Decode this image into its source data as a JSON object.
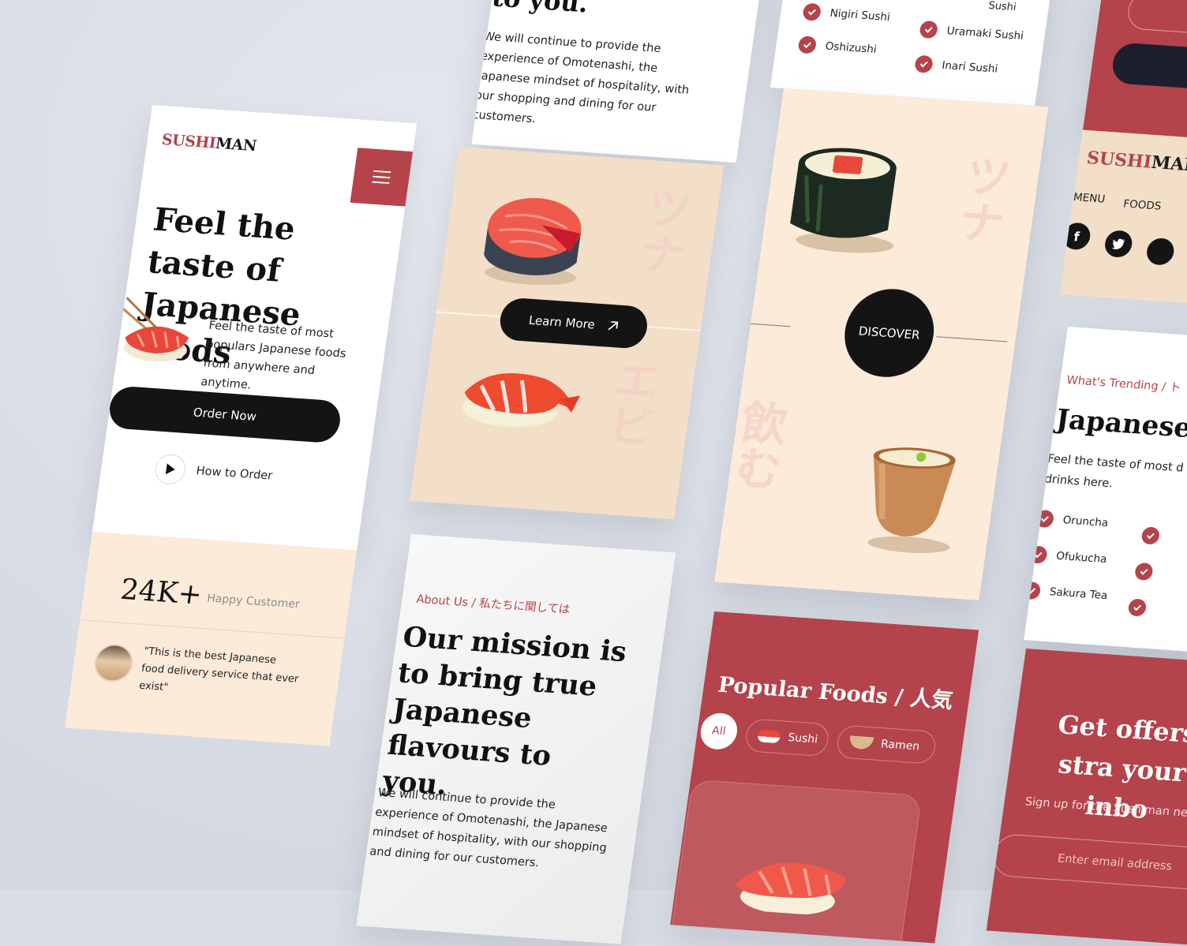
{
  "hero": {
    "brand_red": "SUSHI",
    "brand_dark": "MAN",
    "headline": "Feel the taste of Japanese foods",
    "description": "Feel the taste of most populars Japanese foods from anywhere and anytime.",
    "order_button": "Order Now",
    "how_to_order": "How to Order",
    "stat_number": "24K+",
    "stat_label": "Happy Customer",
    "testimonial": "\"This is the best Japanese food delivery service that ever exist\""
  },
  "about_top": {
    "title_fragment": "to you.",
    "body": "We will continue to provide the experience of Omotenashi, the Japanese mindset of hospitality, with our shopping and dining for our customers."
  },
  "food_showcase": {
    "learn_more": "Learn More",
    "kana_top": "ツナ",
    "kana_bottom": "エビ"
  },
  "about": {
    "eyebrow": "About Us / 私たちに関しては",
    "title": "Our mission is to bring true Japanese flavours to you.",
    "body": "We will continue to provide the experience of Omotenashi, the Japanese mindset of hospitality, with our shopping and dining for our customers."
  },
  "sushi_list": {
    "items": [
      "Nigiri Sushi",
      "Uramaki Sushi",
      "Oshizushi",
      "Inari Sushi"
    ],
    "cutoff": "Sushi"
  },
  "discover": {
    "label": "DISCOVER",
    "kana_top": "ツナ",
    "kana_bottom": "飲む"
  },
  "popular": {
    "title": "Popular Foods / 人気",
    "filters": [
      "All",
      "Sushi",
      "Ramen"
    ]
  },
  "footer_nav": {
    "brand_red": "SUSHI",
    "brand_dark": "MAN",
    "links": [
      "MENU",
      "FOODS"
    ]
  },
  "trending": {
    "eyebrow": "What's Trending / ト",
    "title": "Japanese I",
    "body": "Feel the taste of most d drinks here.",
    "items": [
      "Oruncha",
      "Ofukucha",
      "Sakura Tea"
    ]
  },
  "offers": {
    "title": "Get offers stra your inbo",
    "subtitle": "Sign up for the Sushiman ne",
    "email_placeholder": "Enter email address"
  },
  "colors": {
    "accent": "#b5434b",
    "dark": "#141414",
    "cream": "#fdebd9"
  }
}
